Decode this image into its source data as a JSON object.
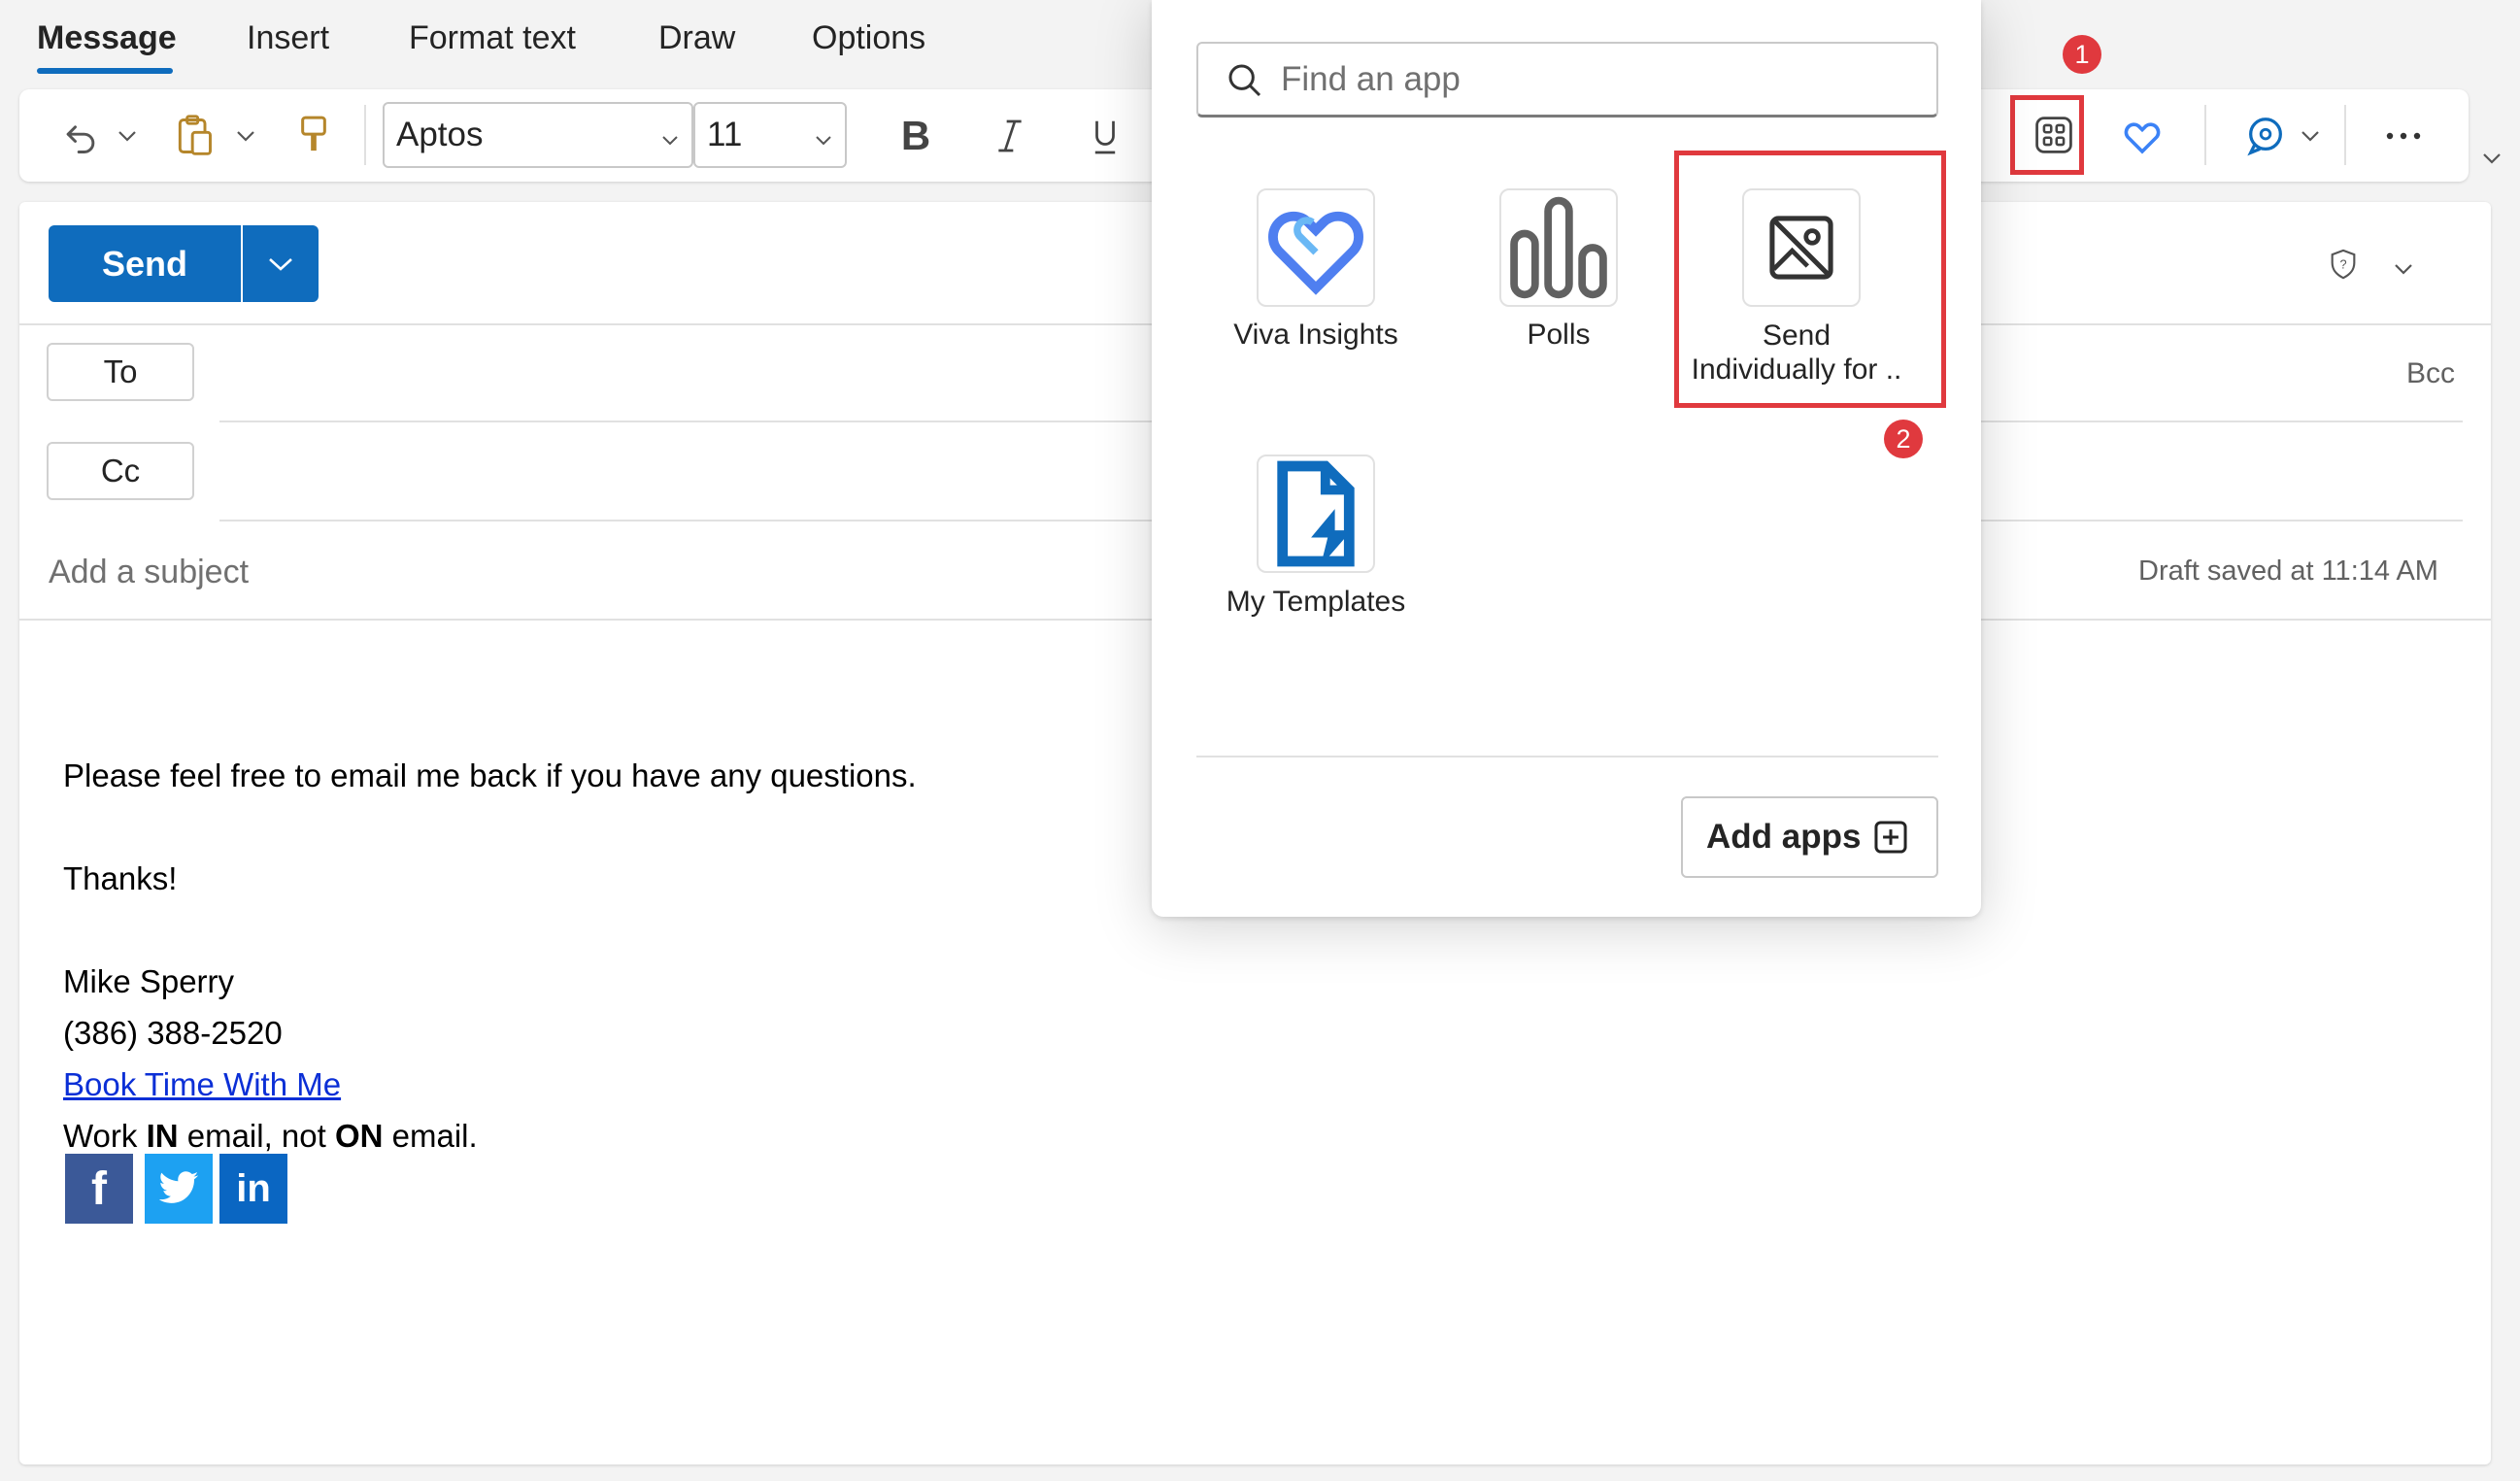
{
  "tabs": [
    "Message",
    "Insert",
    "Format text",
    "Draw",
    "Options"
  ],
  "toolbar": {
    "font_name": "Aptos",
    "font_size": "11"
  },
  "send": {
    "label": "Send"
  },
  "recipients": {
    "to_label": "To",
    "cc_label": "Cc",
    "bcc_label": "Bcc"
  },
  "subject": {
    "placeholder": "Add a subject",
    "draft_status": "Draft saved at 11:14 AM"
  },
  "body": {
    "line1": "Please feel free to email me back if you have any questions.",
    "line2": "Thanks!",
    "name": "Mike Sperry",
    "phone": "(386) 388-2520",
    "link": "Book Time With Me",
    "motto_work": "Work ",
    "motto_in": "IN",
    "motto_mid": " email, not ",
    "motto_on": "ON",
    "motto_end": " email."
  },
  "social": [
    {
      "icon": "facebook-icon",
      "glyph": "f",
      "color": "#3b5998"
    },
    {
      "icon": "twitter-icon",
      "color": "#1da1f2"
    },
    {
      "icon": "linkedin-icon",
      "glyph": "in",
      "color": "#0a66c2"
    }
  ],
  "apps_popup": {
    "search_placeholder": "Find an app",
    "apps": [
      {
        "label": "Viva Insights"
      },
      {
        "label": "Polls"
      },
      {
        "label_line1": "Send",
        "label_line2": "Individually for .."
      },
      {
        "label": "My Templates"
      }
    ],
    "add_apps_label": "Add apps"
  },
  "callouts": {
    "badge1": "1",
    "badge2": "2"
  },
  "colors": {
    "accent": "#0f6cbd",
    "highlight": "#e0393e",
    "link": "#0b2fd6"
  }
}
